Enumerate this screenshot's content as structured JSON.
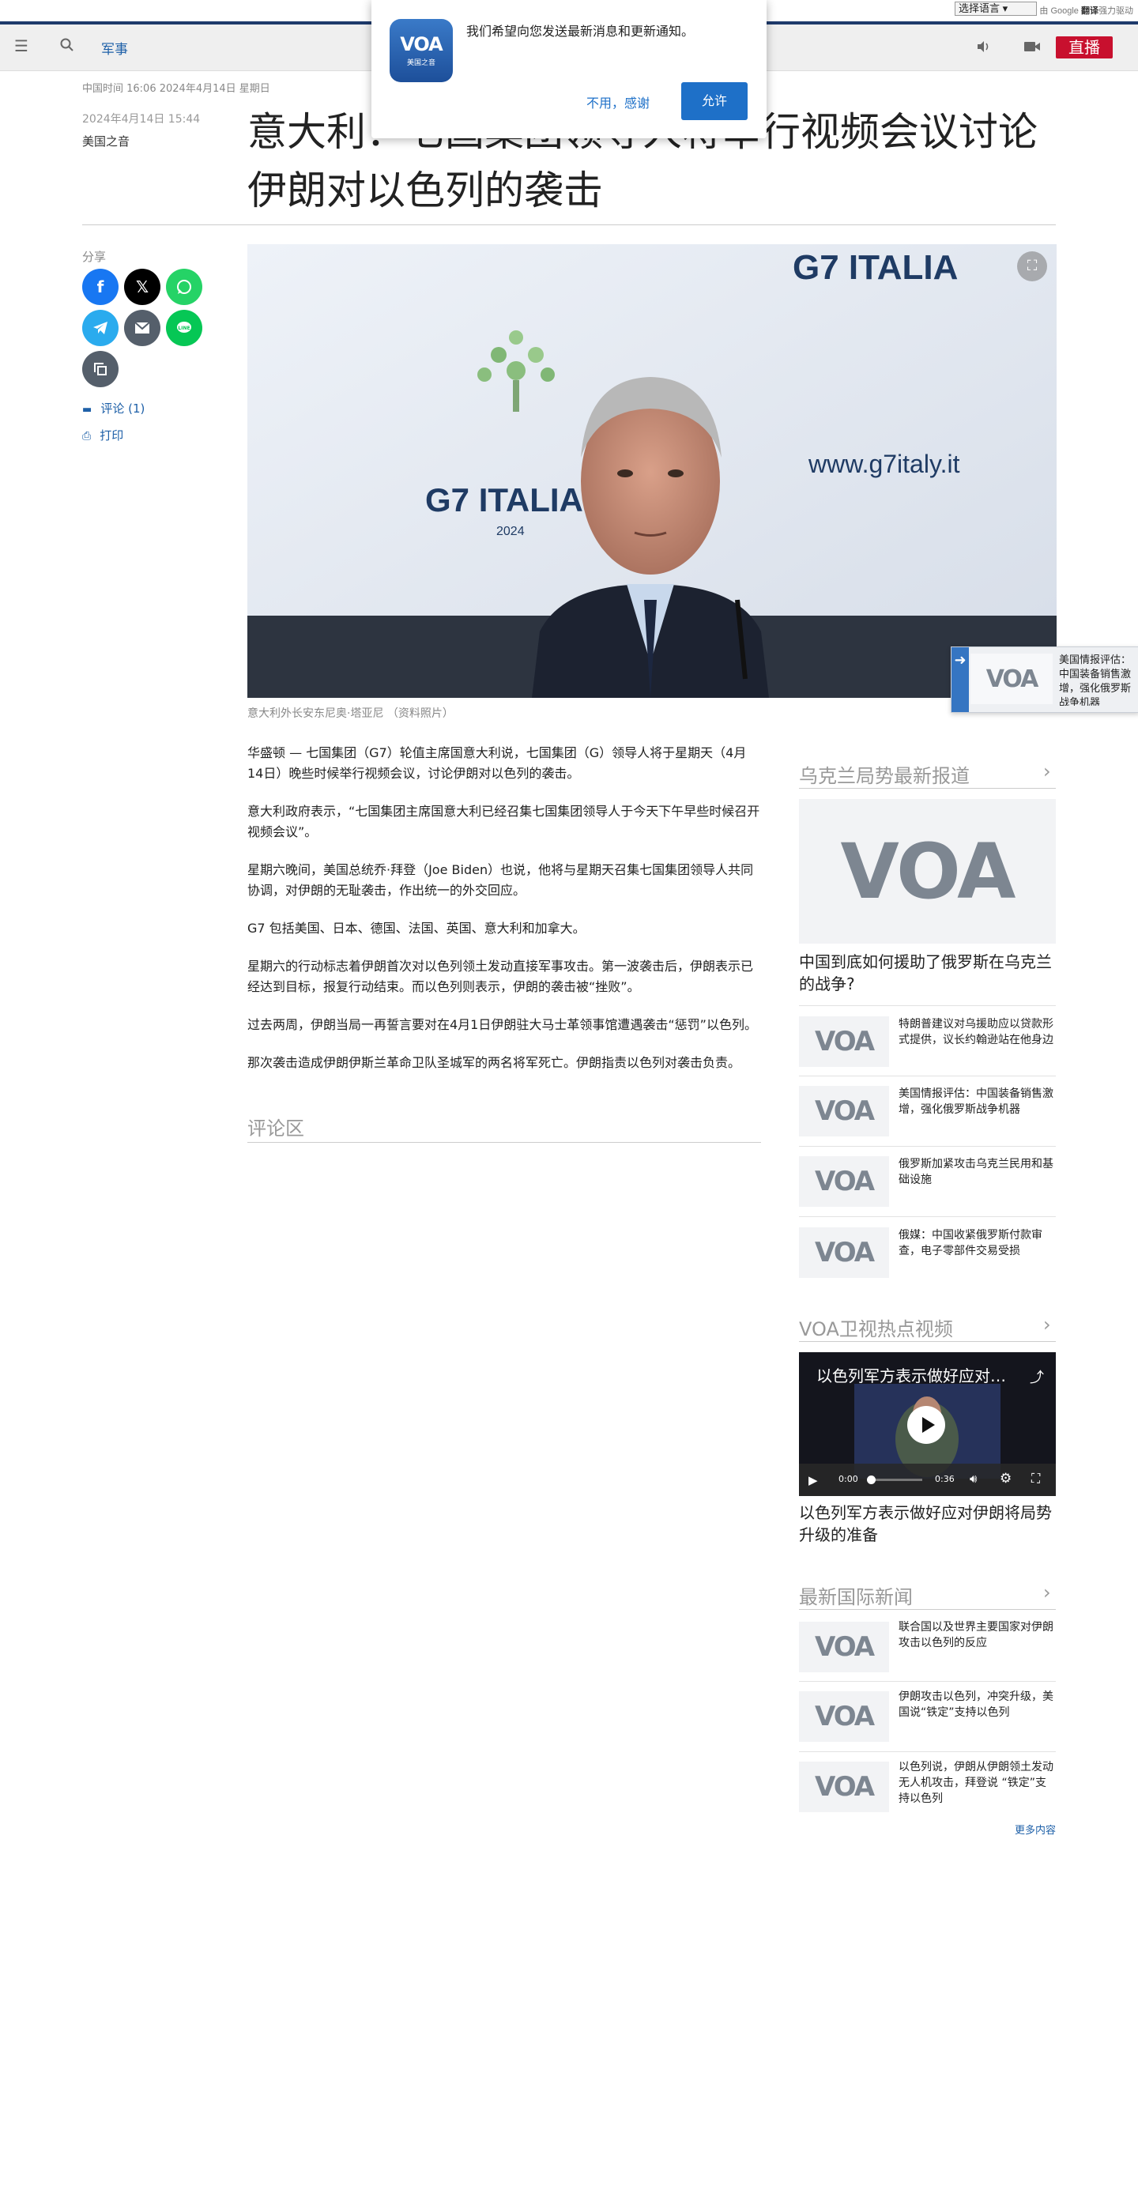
{
  "translate": {
    "select_label": "选择语言",
    "powered_by": "由",
    "google": "Google",
    "translate_word": "翻译",
    "powered_suffix": "强力驱动"
  },
  "nav": {
    "section": "军事",
    "live_label": "直播"
  },
  "popup": {
    "logo_text": "VOA",
    "logo_sub": "美国之音",
    "message": "我们希望向您发送最新消息和更新通知。",
    "decline_label": "不用，感谢",
    "allow_label": "允许"
  },
  "article": {
    "china_time": "中国时间 16:06 2024年4月14日 星期日",
    "published": "2024年4月14日 15:44",
    "source": "美国之音",
    "headline": "意大利：七国集团领导人将举行视频会议讨论伊朗对以色列的袭击",
    "share_label": "分享",
    "comments_link": "评论 (1)",
    "print_link": "打印",
    "hero_text_left": "G7 ITALIA",
    "hero_text_year": "2024",
    "hero_text_right_top": "G7 ITALIA",
    "hero_url": "www.g7italy.it",
    "caption": "意大利外长安东尼奥·塔亚尼 （资料照片）",
    "paragraphs": [
      "华盛顿 — 七国集团（G7）轮值主席国意大利说，七国集团（G）领导人将于星期天（4月14日）晚些时候举行视频会议，讨论伊朗对以色列的袭击。",
      "意大利政府表示，“七国集团主席国意大利已经召集七国集团领导人于今天下午早些时候召开视频会议”。",
      "星期六晚间，美国总统乔·拜登（Joe Biden）也说，他将与星期天召集七国集团领导人共同协调，对伊朗的无耻袭击，作出统一的外交回应。",
      "G7 包括美国、日本、德国、法国、英国、意大利和加拿大。",
      "星期六的行动标志着伊朗首次对以色列领土发动直接军事攻击。第一波袭击后，伊朗表示已经达到目标，报复行动结束。而以色列则表示，伊朗的袭击被“挫败”。",
      "过去两周，伊朗当局一再誓言要对在4月1日伊朗驻大马士革领事馆遭遇袭击“惩罚”以色列。",
      "那次袭击造成伊朗伊斯兰革命卫队圣城军的两名将军死亡。伊朗指责以色列对袭击负责。"
    ],
    "comments_title": "评论区"
  },
  "sidebar": {
    "ukraine": {
      "title": "乌克兰局势最新报道",
      "lead": "中国到底如何援助了俄罗斯在乌克兰的战争?",
      "items": [
        "特朗普建议对乌援助应以贷款形式提供，议长约翰逊站在他身边",
        "美国情报评估：中国装备销售激增，强化俄罗斯战争机器",
        "俄罗斯加紧攻击乌克兰民用和基础设施",
        "俄媒：中国收紧俄罗斯付款审查，电子零部件交易受损"
      ]
    },
    "video": {
      "title": "VOA卫视热点视频",
      "video_title": "以色列军方表示做好应对伊朗将局势升级的准备",
      "time_current": "0:00",
      "time_total": "0:36",
      "caption": "以色列军方表示做好应对伊朗将局势升级的准备"
    },
    "world": {
      "title": "最新国际新闻",
      "items": [
        "联合国以及世界主要国家对伊朗攻击以色列的反应",
        "伊朗攻击以色列，冲突升级，美国说“铁定”支持以色列",
        "以色列说，伊朗从伊朗领土发动无人机攻击，拜登说 “铁定”支持以色列"
      ],
      "more": "更多内容"
    },
    "floating": {
      "text": "美国情报评估：中国装备销售激增，强化俄罗斯战争机器"
    }
  },
  "colors": {
    "brand_blue": "#1e60a8",
    "live_red": "#c8102e",
    "allow_blue": "#1e70c8",
    "facebook": "#1877f2",
    "x": "#000000",
    "whatsapp": "#25d366",
    "telegram": "#2aabee",
    "email": "#555f6b",
    "line": "#06c755",
    "copy": "#555f6b"
  },
  "icons": {
    "menu": "hamburger-icon",
    "search": "search-icon",
    "audio": "speaker-icon",
    "video": "video-camera-icon"
  }
}
